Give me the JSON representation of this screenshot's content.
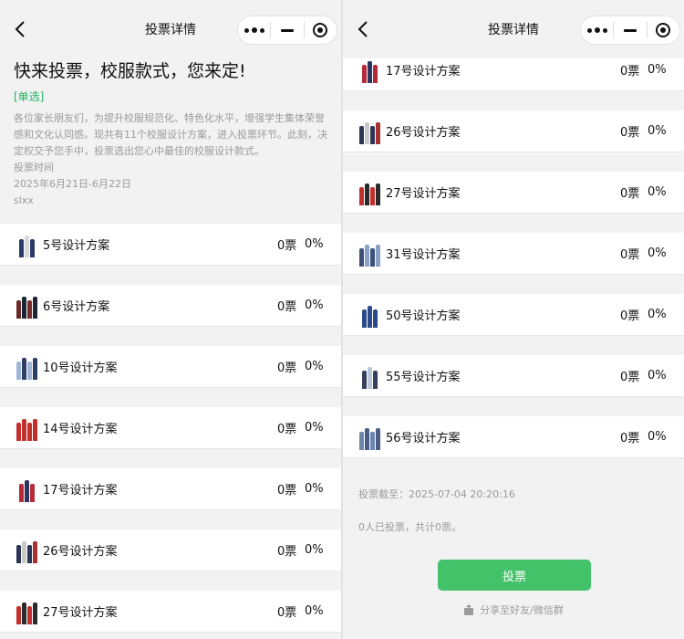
{
  "nav": {
    "title": "投票详情"
  },
  "vote": {
    "title": "快来投票，校服款式，您来定!",
    "type": "[单选]",
    "description": "各位家长朋友们，为提升校服规范化、特色化水平，增强学生集体荣誉感和文化认同感。现共有11个校服设计方案，进入投票环节。此刻，决定权交予您手中，投票选出您心中最佳的校服设计款式。",
    "time_label": "投票时间",
    "time_range": "2025年6月21日-6月22日",
    "author": "slxx"
  },
  "colors": {
    "accent": "#43c26a",
    "type_text": "#1fb060"
  },
  "options_left": [
    {
      "name": "5号设计方案",
      "votes": "0票",
      "percent": "0%",
      "icon": "uniform-5-thumbnail",
      "palette": [
        "#2b3a6a",
        "#d9d9d9",
        "#2b3a6a"
      ]
    },
    {
      "name": "6号设计方案",
      "votes": "0票",
      "percent": "0%",
      "icon": "uniform-6-thumbnail",
      "palette": [
        "#6b2a2a",
        "#1d2433",
        "#7a2b2b",
        "#1d2433"
      ]
    },
    {
      "name": "10号设计方案",
      "votes": "0票",
      "percent": "0%",
      "icon": "uniform-10-thumbnail",
      "palette": [
        "#9fb6d8",
        "#2d3e63",
        "#9fb6d8",
        "#2d3e63"
      ]
    },
    {
      "name": "14号设计方案",
      "votes": "0票",
      "percent": "0%",
      "icon": "uniform-14-thumbnail",
      "palette": [
        "#c0312d",
        "#c0312d",
        "#c0312d",
        "#c0312d"
      ]
    },
    {
      "name": "17号设计方案",
      "votes": "0票",
      "percent": "0%",
      "icon": "uniform-17-thumbnail",
      "palette": [
        "#b52a3a",
        "#2c3460",
        "#b52a3a"
      ]
    },
    {
      "name": "26号设计方案",
      "votes": "0票",
      "percent": "0%",
      "icon": "uniform-26-thumbnail",
      "palette": [
        "#2c3556",
        "#c9c9c9",
        "#2c3556",
        "#a43030"
      ]
    },
    {
      "name": "27号设计方案",
      "votes": "0票",
      "percent": "0%",
      "icon": "uniform-27-thumbnail",
      "palette": [
        "#c0312d",
        "#2a2a2a",
        "#c0312d",
        "#2a2a2a"
      ]
    }
  ],
  "options_right": [
    {
      "name": "17号设计方案",
      "votes": "0票",
      "percent": "0%",
      "icon": "uniform-17-thumbnail",
      "palette": [
        "#b52a3a",
        "#2c3460",
        "#b52a3a"
      ]
    },
    {
      "name": "26号设计方案",
      "votes": "0票",
      "percent": "0%",
      "icon": "uniform-26-thumbnail",
      "palette": [
        "#2c3556",
        "#c9c9c9",
        "#2c3556",
        "#a43030"
      ]
    },
    {
      "name": "27号设计方案",
      "votes": "0票",
      "percent": "0%",
      "icon": "uniform-27-thumbnail",
      "palette": [
        "#c0312d",
        "#2a2a2a",
        "#c0312d",
        "#2a2a2a"
      ]
    },
    {
      "name": "31号设计方案",
      "votes": "0票",
      "percent": "0%",
      "icon": "uniform-31-thumbnail",
      "palette": [
        "#3d4f7a",
        "#8aa0c4",
        "#3d4f7a",
        "#8aa0c4"
      ]
    },
    {
      "name": "50号设计方案",
      "votes": "0票",
      "percent": "0%",
      "icon": "uniform-50-thumbnail",
      "palette": [
        "#2c4a8a",
        "#2c4a8a",
        "#2c4a8a"
      ]
    },
    {
      "name": "55号设计方案",
      "votes": "0票",
      "percent": "0%",
      "icon": "uniform-55-thumbnail",
      "palette": [
        "#35405e",
        "#b9c5db",
        "#35405e"
      ]
    },
    {
      "name": "56号设计方案",
      "votes": "0票",
      "percent": "0%",
      "icon": "uniform-56-thumbnail",
      "palette": [
        "#6d86b0",
        "#4b5d85",
        "#6d86b0",
        "#4b5d85"
      ]
    }
  ],
  "footer": {
    "deadline": "投票截至：2025-07-04 20:20:16",
    "summary": "0人已投票，共计0票。",
    "vote_button": "投票",
    "share": "分享至好友/微信群"
  }
}
